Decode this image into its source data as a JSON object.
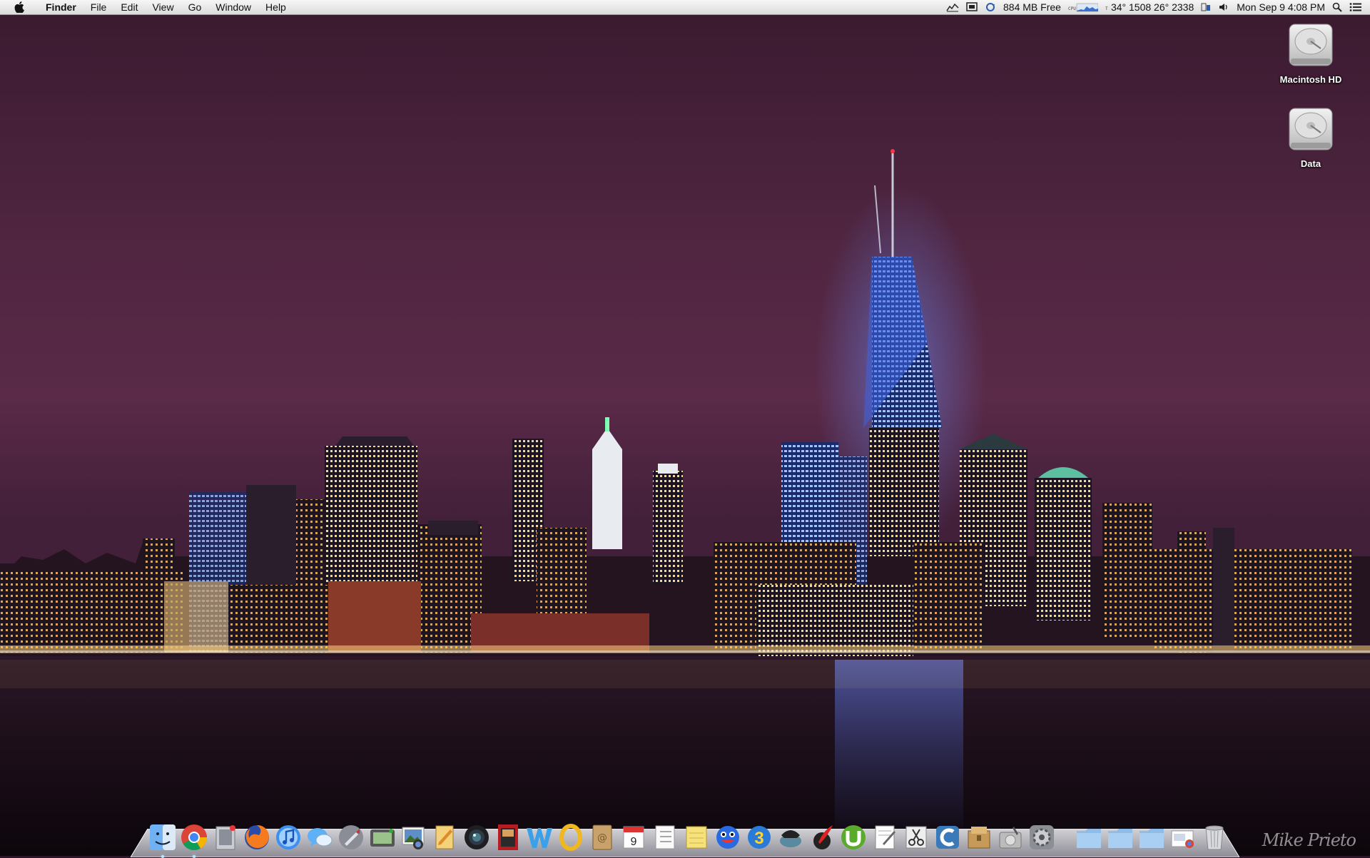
{
  "menubar": {
    "apple_menu": "apple-icon",
    "app_name": "Finder",
    "menus": [
      "File",
      "Edit",
      "View",
      "Go",
      "Window",
      "Help"
    ],
    "status": {
      "memory": "884 MB Free",
      "temps": "34° 1508 26° 2338",
      "clock": "Mon Sep 9  4:08 PM"
    }
  },
  "desktop": {
    "icons": [
      {
        "label": "Macintosh HD",
        "icon": "hard-drive-icon"
      },
      {
        "label": "Data",
        "icon": "hard-drive-icon"
      }
    ]
  },
  "dock": {
    "apps": [
      "finder-icon",
      "chrome-icon",
      "mail-stamp-icon",
      "firefox-icon",
      "itunes-icon",
      "messages-icon",
      "launchpad-icon",
      "image-capture-icon",
      "iphoto-icon",
      "pages-icon",
      "aperture-icon",
      "photo-booth-icon",
      "word-icon",
      "o-app-icon",
      "address-book-icon",
      "calendar-icon",
      "reminders-icon",
      "notes-icon",
      "smiley-app-icon",
      "blue-3-icon",
      "phone-icon",
      "quill-icon",
      "utorrent-icon",
      "textedit-icon",
      "scissors-app-icon",
      "c-app-icon",
      "archive-utility-icon",
      "disk-utility-icon",
      "system-preferences-icon"
    ],
    "calendar_day": "9",
    "stacks": [
      "applications-folder-icon",
      "documents-folder-icon",
      "downloads-folder-icon",
      "file-stack-icon",
      "trash-icon"
    ]
  },
  "watermark": "Mike Prieto",
  "colors": {
    "sky_top": "#3b1a2e",
    "sky_mid": "#5a2a44",
    "water": "#140a12",
    "tower": "#4a78ff"
  }
}
